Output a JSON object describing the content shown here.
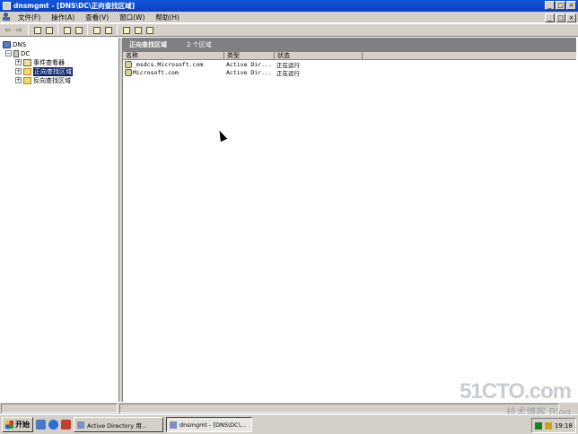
{
  "window": {
    "title": "dnsmgmt - [DNS\\DC\\正向查找区域]",
    "min": "_",
    "max": "□",
    "close": "×"
  },
  "menu": [
    "文件(F)",
    "操作(A)",
    "查看(V)",
    "窗口(W)",
    "帮助(H)"
  ],
  "tree": {
    "root": "DNS",
    "server": "DC",
    "items": [
      "事件查看器",
      "正向查找区域",
      "反向查找区域"
    ]
  },
  "right": {
    "header": "正向查找区域",
    "count": "2 个区域",
    "columns": [
      "名称",
      "类型",
      "状态"
    ],
    "rows": [
      {
        "name": "_msdcs.Microsoft.com",
        "type": "Active Dir...",
        "status": "正在运行"
      },
      {
        "name": "Microsoft.com",
        "type": "Active Dir...",
        "status": "正在运行"
      }
    ]
  },
  "taskbar": {
    "start": "开始",
    "tasks": [
      "Active Directory 用...",
      "dnsmgmt - [DNS\\DC\\..."
    ],
    "clock": "19:18"
  },
  "watermark": {
    "big": "51CTO.com",
    "small": "技术博客 Blog"
  }
}
